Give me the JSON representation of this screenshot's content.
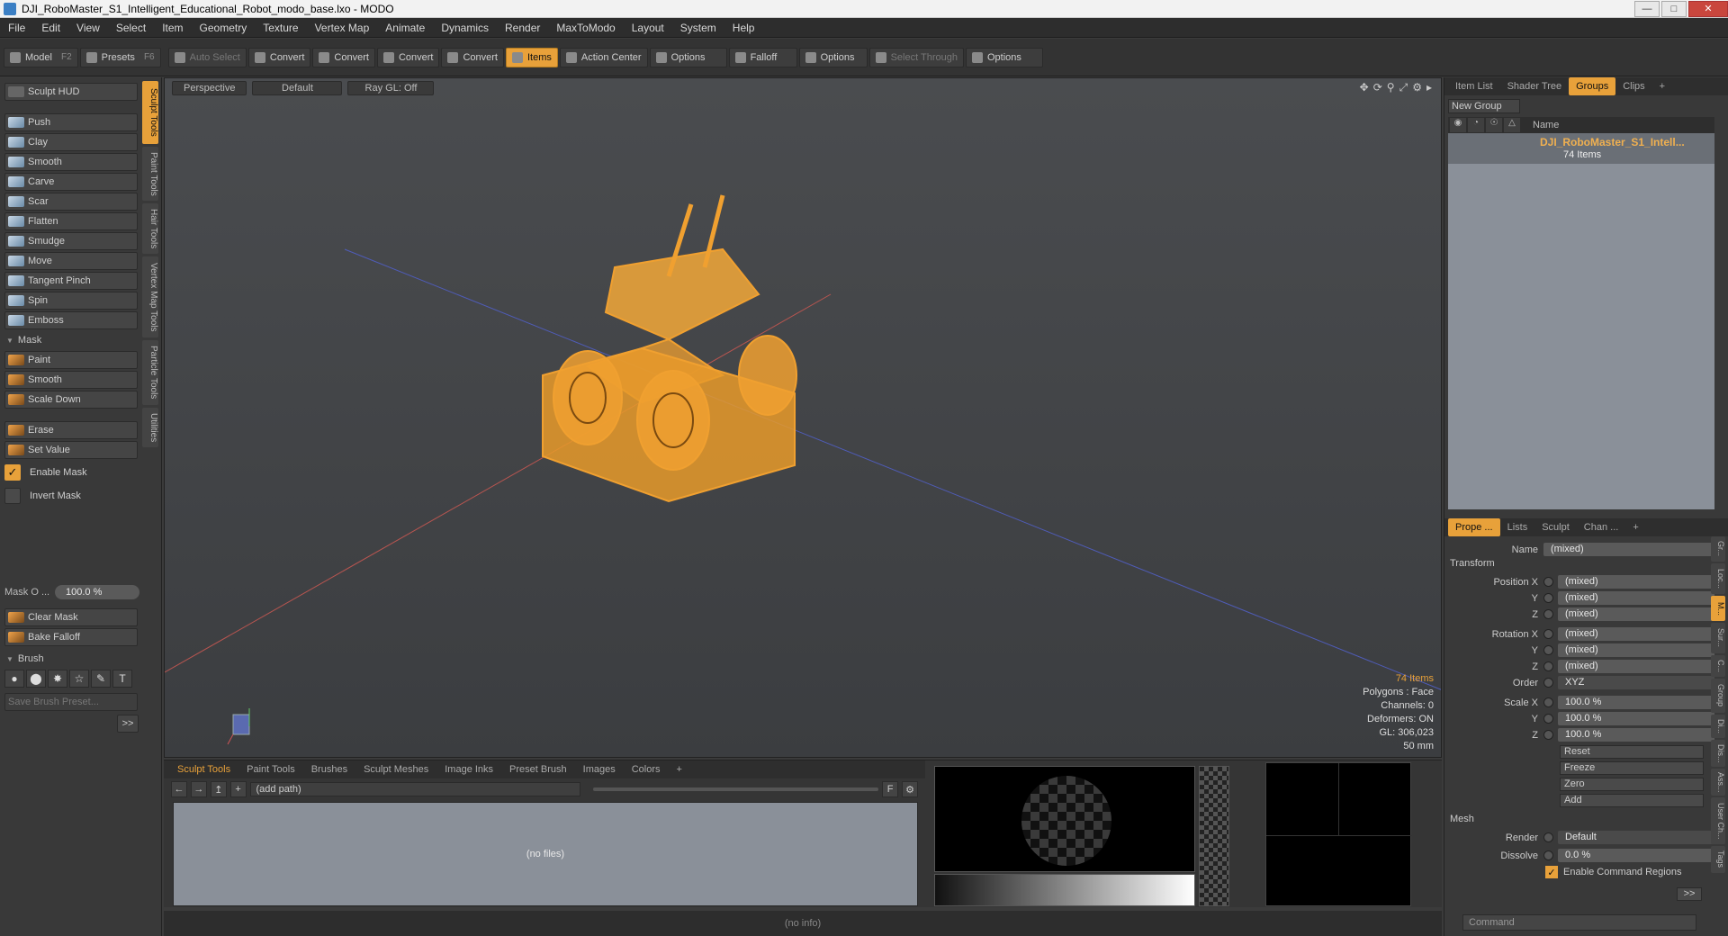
{
  "window": {
    "title": "DJI_RoboMaster_S1_Intelligent_Educational_Robot_modo_base.lxo - MODO"
  },
  "menu": [
    "File",
    "Edit",
    "View",
    "Select",
    "Item",
    "Geometry",
    "Texture",
    "Vertex Map",
    "Animate",
    "Dynamics",
    "Render",
    "MaxToModo",
    "Layout",
    "System",
    "Help"
  ],
  "toolbar": {
    "model": "Model",
    "model_key": "F2",
    "presets": "Presets",
    "presets_key": "F6",
    "auto_select": "Auto Select",
    "convert1": "Convert",
    "convert2": "Convert",
    "convert3": "Convert",
    "convert4": "Convert",
    "items": "Items",
    "action_center": "Action Center",
    "options1": "Options",
    "falloff": "Falloff",
    "options2": "Options",
    "select_through": "Select Through",
    "options3": "Options"
  },
  "left": {
    "sculpt_hud": "Sculpt HUD",
    "tools": [
      "Push",
      "Clay",
      "Smooth",
      "Carve",
      "Scar",
      "Flatten",
      "Smudge",
      "Move",
      "Tangent Pinch",
      "Spin",
      "Emboss"
    ],
    "mask_header": "Mask",
    "mask_tools": [
      "Paint",
      "Smooth",
      "Scale Down"
    ],
    "erase": "Erase",
    "set_value": "Set Value",
    "enable_mask": "Enable Mask",
    "invert_mask": "Invert Mask",
    "mask_opacity_label": "Mask O ...",
    "mask_opacity_value": "100.0 %",
    "clear_mask": "Clear Mask",
    "bake_falloff": "Bake Falloff",
    "brush_header": "Brush",
    "save_brush": "Save Brush Preset...",
    "more": ">>",
    "vtabs": [
      "Sculpt Tools",
      "Paint Tools",
      "Hair Tools",
      "Vertex Map Tools",
      "Particle Tools",
      "Utilities"
    ]
  },
  "viewport": {
    "tabs": [
      "Perspective",
      "Default",
      "Ray GL: Off"
    ],
    "stats": {
      "items": "74 Items",
      "polygons": "Polygons : Face",
      "channels": "Channels: 0",
      "deformers": "Deformers: ON",
      "gl": "GL: 306,023",
      "scale": "50 mm"
    }
  },
  "bottom": {
    "tabs": [
      "Sculpt Tools",
      "Paint Tools",
      "Brushes",
      "Sculpt Meshes",
      "Image Inks",
      "Preset Brush",
      "Images",
      "Colors",
      "+"
    ],
    "path": "(add path)",
    "no_files": "(no files)",
    "status": "(no info)"
  },
  "right": {
    "tabs": [
      "Item List",
      "Shader Tree",
      "Groups",
      "Clips",
      "+"
    ],
    "new_group": "New Group",
    "name_col": "Name",
    "group_name": "DJI_RoboMaster_S1_Intell...",
    "group_count": "74 Items",
    "prop_tabs": [
      "Prope ...",
      "Lists",
      "Sculpt",
      "Chan ...",
      "+"
    ],
    "name_label": "Name",
    "name_value": "(mixed)",
    "transform": "Transform",
    "position_x_label": "Position X",
    "y_label": "Y",
    "z_label": "Z",
    "rotation_x_label": "Rotation X",
    "scale_x_label": "Scale X",
    "mixed": "(mixed)",
    "order_label": "Order",
    "order_value": "XYZ",
    "scale_value": "100.0 %",
    "reset": "Reset",
    "freeze": "Freeze",
    "zero": "Zero",
    "add": "Add",
    "mesh": "Mesh",
    "render_label": "Render",
    "render_value": "Default",
    "dissolve_label": "Dissolve",
    "dissolve_value": "0.0 %",
    "enable_cmd": "Enable Command Regions",
    "more": ">>",
    "command_placeholder": "Command",
    "vtabs": [
      "Gr...",
      "Loc...",
      "M...",
      "Sur...",
      "C...",
      "Group",
      "Di...",
      "Dis...",
      "Ass...",
      "User Ch...",
      "Tags"
    ]
  },
  "colors": {
    "accent": "#e8a13a"
  }
}
